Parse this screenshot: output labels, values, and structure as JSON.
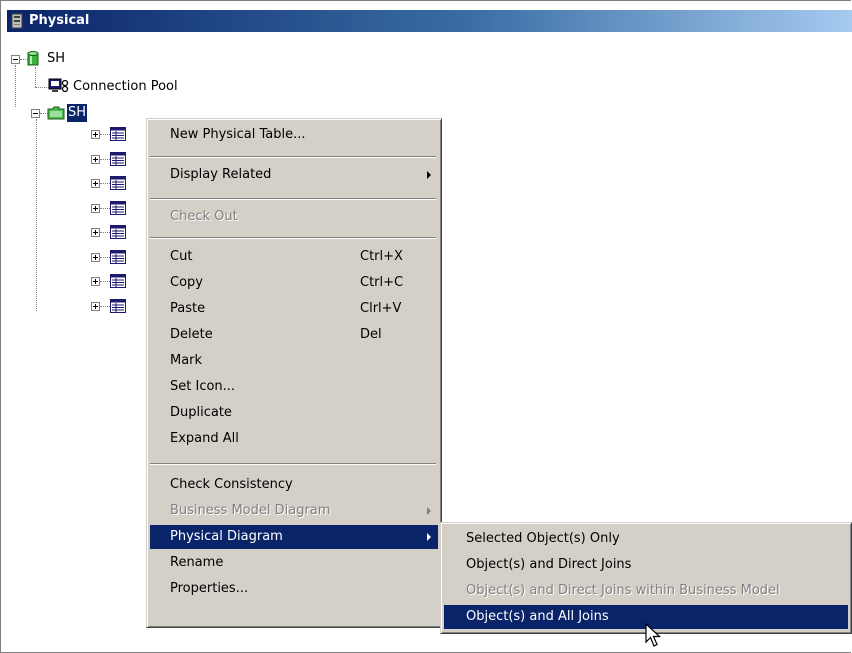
{
  "window": {
    "title": "Physical"
  },
  "tree": {
    "root_label": "SH",
    "connection_pool_label": "Connection Pool",
    "schema_label": "SH",
    "table_count": 8
  },
  "context_menu": {
    "items": [
      {
        "label": "New Physical Table...",
        "shortcut": "",
        "enabled": true,
        "submenu": false
      },
      {
        "label": "Display Related",
        "shortcut": "",
        "enabled": true,
        "submenu": true
      },
      {
        "label": "Check Out",
        "shortcut": "",
        "enabled": false,
        "submenu": false
      },
      {
        "label": "Cut",
        "shortcut": "Ctrl+X",
        "enabled": true,
        "submenu": false
      },
      {
        "label": "Copy",
        "shortcut": "Ctrl+C",
        "enabled": true,
        "submenu": false
      },
      {
        "label": "Paste",
        "shortcut": "Clrl+V",
        "enabled": true,
        "submenu": false
      },
      {
        "label": "Delete",
        "shortcut": "Del",
        "enabled": true,
        "submenu": false
      },
      {
        "label": "Mark",
        "shortcut": "",
        "enabled": true,
        "submenu": false
      },
      {
        "label": "Set Icon...",
        "shortcut": "",
        "enabled": true,
        "submenu": false
      },
      {
        "label": "Duplicate",
        "shortcut": "",
        "enabled": true,
        "submenu": false
      },
      {
        "label": "Expand All",
        "shortcut": "",
        "enabled": true,
        "submenu": false
      },
      {
        "label": "Check Consistency",
        "shortcut": "",
        "enabled": true,
        "submenu": false
      },
      {
        "label": "Business Model Diagram",
        "shortcut": "",
        "enabled": false,
        "submenu": true
      },
      {
        "label": "Physical Diagram",
        "shortcut": "",
        "enabled": true,
        "submenu": true,
        "highlighted": true
      },
      {
        "label": "Rename",
        "shortcut": "",
        "enabled": true,
        "submenu": false
      },
      {
        "label": "Properties...",
        "shortcut": "",
        "enabled": true,
        "submenu": false
      }
    ]
  },
  "submenu": {
    "items": [
      {
        "label": "Selected Object(s) Only",
        "enabled": true
      },
      {
        "label": "Object(s) and Direct Joins",
        "enabled": true
      },
      {
        "label": "Object(s) and Direct Joins within Business Model",
        "enabled": false
      },
      {
        "label": "Object(s) and All Joins",
        "enabled": true,
        "highlighted": true
      }
    ]
  },
  "colors": {
    "title_bar": "#0a246a",
    "menu_bg": "#d4d0c8",
    "highlight": "#0a246a",
    "disabled_text": "#808080"
  },
  "icons": {
    "title": "server-icon",
    "database": "database-cylinder-icon",
    "connection_pool": "connection-pool-icon",
    "schema": "folder-icon",
    "table": "table-icon"
  }
}
